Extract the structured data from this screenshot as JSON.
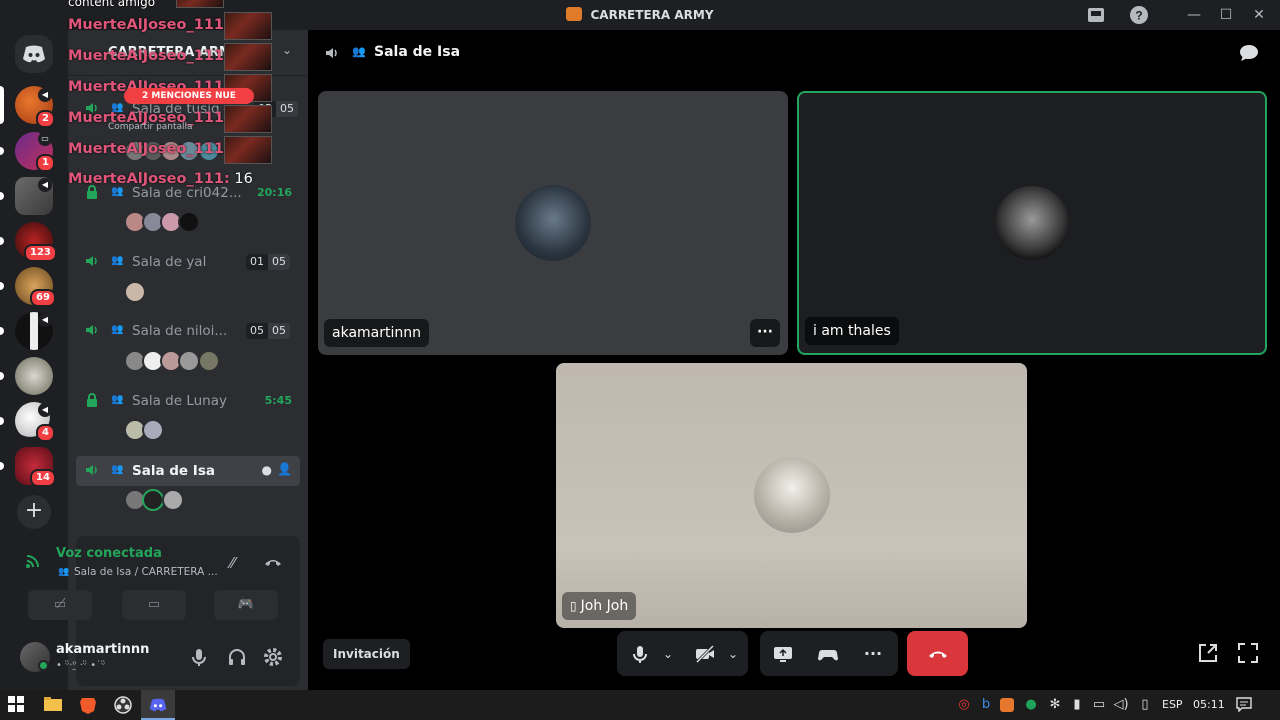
{
  "window": {
    "title": "CARRETERA ARMY",
    "controls": {
      "inbox": "inbox-icon",
      "help": "?",
      "minimize": "—",
      "maximize": "☐",
      "close": "✕"
    }
  },
  "servers": [
    {
      "badge": "2"
    },
    {
      "badge": "1"
    },
    {
      "badge": ""
    },
    {
      "badge": "123"
    },
    {
      "badge": "69"
    },
    {
      "badge": ""
    },
    {
      "badge": ""
    },
    {
      "badge": "4"
    },
    {
      "badge": "14"
    }
  ],
  "server_header": {
    "name": "CARRETERA ARM"
  },
  "overlay": {
    "top_text": "content amigo",
    "lines": [
      {
        "name": "MuerteAlJoseo_111",
        "sep": ":",
        "value": ""
      },
      {
        "name": "MuerteAlJoseo_111",
        "sep": ":",
        "value": ""
      },
      {
        "name": "MuerteAlJoseo_111",
        "sep": ":",
        "value": ""
      },
      {
        "name": "MuerteAlJoseo_111",
        "sep": ":",
        "value": ""
      },
      {
        "name": "MuerteAlJoseo_111",
        "sep": ":",
        "value": ""
      },
      {
        "name": "MuerteAlJoseo_111",
        "sep": ":",
        "value": " 16"
      }
    ],
    "mention_banner": "2 MENCIONES NUE",
    "share_label": "Compartir pantalla"
  },
  "channels": [
    {
      "name": "Sala de tusiq",
      "count_a": "05",
      "count_b": "05",
      "time": "",
      "locked": false
    },
    {
      "name": "Sala de cri042...",
      "count_a": "",
      "count_b": "",
      "time": "20:16",
      "locked": true
    },
    {
      "name": "Sala de yal",
      "count_a": "01",
      "count_b": "05",
      "time": "",
      "locked": false
    },
    {
      "name": "Sala de niloi...",
      "count_a": "05",
      "count_b": "05",
      "time": "",
      "locked": false
    },
    {
      "name": "Sala de Lunay",
      "count_a": "",
      "count_b": "",
      "time": "5:45",
      "locked": true
    },
    {
      "name": "Sala de Isa",
      "count_a": "",
      "count_b": "",
      "time": "",
      "locked": false,
      "active": true
    }
  ],
  "voice_panel": {
    "status": "Voz conectada",
    "location": "Sala de Isa / CARRETERA ..."
  },
  "user_panel": {
    "username": "akamartinnn",
    "status": "• ᵕ̈·ᵒ̰ ·ᵕ̈ •˙ᵕ̈"
  },
  "main_header": {
    "channel_name": "Sala de Isa"
  },
  "tiles": [
    {
      "label": "akamartinnn"
    },
    {
      "label": "i am thales"
    },
    {
      "label": "Joh Joh"
    }
  ],
  "controls": {
    "invite_label": "Invitación"
  },
  "taskbar": {
    "language": "ESP",
    "clock": "05:11"
  },
  "colors": {
    "accent_green": "#23a55a",
    "mention_red": "#f23f43",
    "hangup_red": "#da373c",
    "overlay_pink": "#e0567a"
  }
}
